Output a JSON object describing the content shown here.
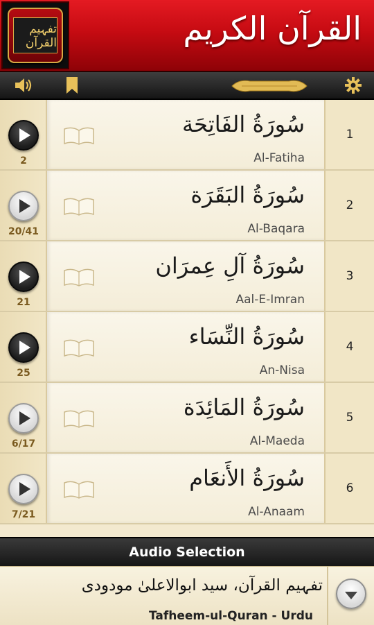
{
  "header": {
    "title_ar": "القرآن الكريم",
    "logo_text": "تفہیم القرآن"
  },
  "toolbar": {
    "icons": [
      "speaker-icon",
      "bookmark-icon",
      "ornament-banner",
      "settings-icon"
    ]
  },
  "colors": {
    "header_red": "#c60b12",
    "gold": "#e8c15a",
    "parchment": "#f3e9cf"
  },
  "surahs": [
    {
      "number": "1",
      "name_ar": "سُورَةُ الفَاتِحَة",
      "name_en": "Al-Fatiha",
      "count": "2",
      "play_style": "dark"
    },
    {
      "number": "2",
      "name_ar": "سُورَةُ البَقَرَة",
      "name_en": "Al-Baqara",
      "count": "20/41",
      "play_style": "light"
    },
    {
      "number": "3",
      "name_ar": "سُورَةُ آلِ عِمرَان",
      "name_en": "Aal-E-Imran",
      "count": "21",
      "play_style": "dark"
    },
    {
      "number": "4",
      "name_ar": "سُورَةُ النِّسَاء",
      "name_en": "An-Nisa",
      "count": "25",
      "play_style": "dark"
    },
    {
      "number": "5",
      "name_ar": "سُورَةُ المَائِدَة",
      "name_en": "Al-Maeda",
      "count": "6/17",
      "play_style": "light"
    },
    {
      "number": "6",
      "name_ar": "سُورَةُ الأَنعَام",
      "name_en": "Al-Anaam",
      "count": "7/21",
      "play_style": "light"
    }
  ],
  "footer": {
    "audio_label": "Audio Selection",
    "selection_ar": "تفہیم القرآن، سید ابوالاعلیٰ مودودی",
    "selection_en": "Tafheem-ul-Quran - Urdu"
  }
}
